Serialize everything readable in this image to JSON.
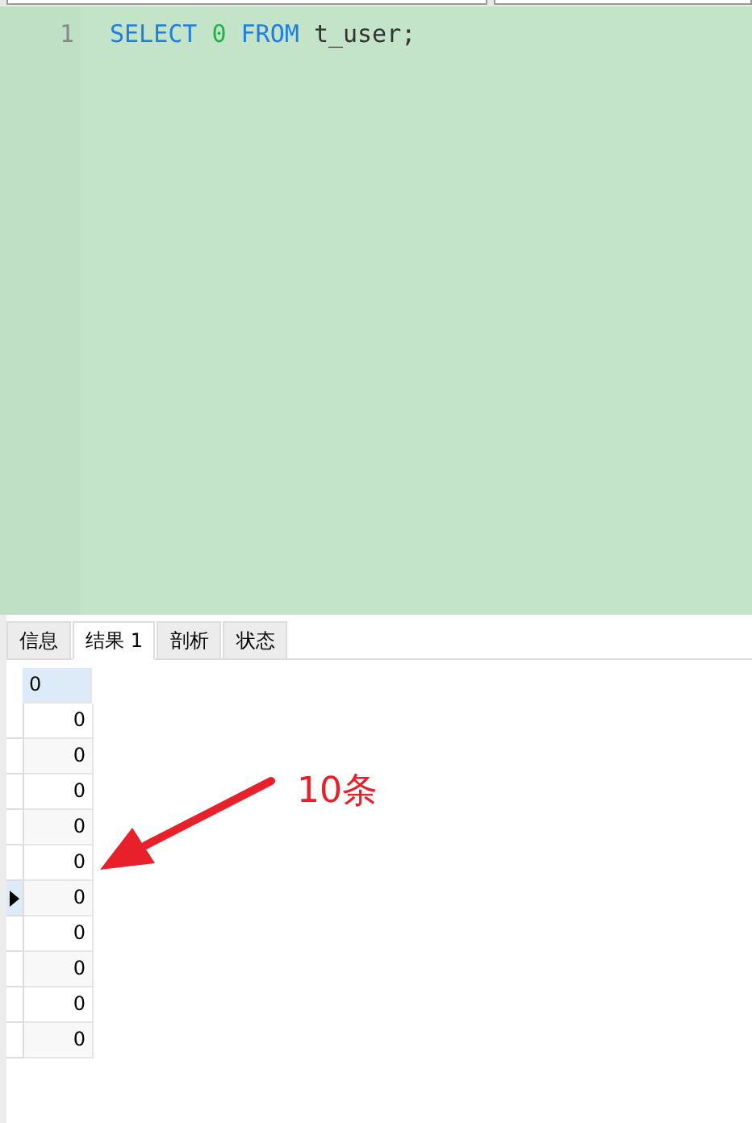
{
  "editor": {
    "lines": [
      {
        "number": "1",
        "tokens": [
          {
            "text": "SELECT",
            "kind": "keyword"
          },
          {
            "text": "0",
            "kind": "number"
          },
          {
            "text": "FROM",
            "kind": "keyword"
          },
          {
            "text": "t_user;",
            "kind": "plain"
          }
        ]
      }
    ]
  },
  "tabs": [
    {
      "label": "信息",
      "selected": false
    },
    {
      "label": "结果 1",
      "selected": true
    },
    {
      "label": "剖析",
      "selected": false
    },
    {
      "label": "状态",
      "selected": false
    }
  ],
  "grid": {
    "column": "0",
    "rows": [
      {
        "value": "0",
        "current": false
      },
      {
        "value": "0",
        "current": false
      },
      {
        "value": "0",
        "current": false
      },
      {
        "value": "0",
        "current": false
      },
      {
        "value": "0",
        "current": false
      },
      {
        "value": "0",
        "current": true
      },
      {
        "value": "0",
        "current": false
      },
      {
        "value": "0",
        "current": false
      },
      {
        "value": "0",
        "current": false
      },
      {
        "value": "0",
        "current": false
      }
    ]
  },
  "annotation": {
    "text": "10条"
  }
}
